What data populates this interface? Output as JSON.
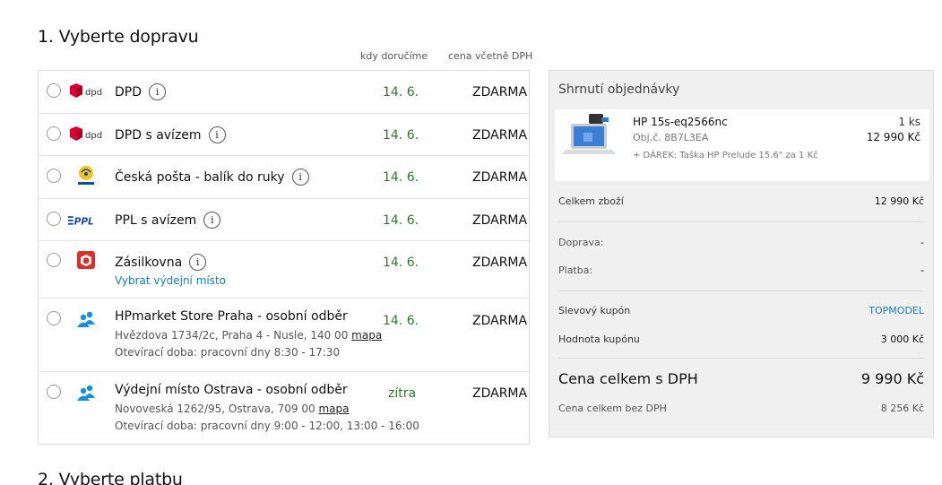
{
  "section1_title": "1. Vyberte dopravu",
  "section2_title": "2. Vyberte platbu",
  "columns": {
    "when": "kdy doručíme",
    "price": "cena včetně DPH"
  },
  "shipping": [
    {
      "name": "DPD",
      "logo": "dpd-logo",
      "date": "14. 6.",
      "price": "ZDARMA"
    },
    {
      "name": "DPD s avízem",
      "logo": "dpd-logo",
      "date": "14. 6.",
      "price": "ZDARMA"
    },
    {
      "name": "Česká pošta - balík do ruky",
      "logo": "ceska-posta-logo",
      "date": "14. 6.",
      "price": "ZDARMA"
    },
    {
      "name": "PPL s avízem",
      "logo": "ppl-logo",
      "date": "14. 6.",
      "price": "ZDARMA"
    },
    {
      "name": "Zásilkovna",
      "logo": "zasilkovna-logo",
      "date": "14. 6.",
      "price": "ZDARMA",
      "link": "Vybrat výdejní místo"
    },
    {
      "name": "HPmarket Store Praha - osobní odběr",
      "logo": "people-icon",
      "date": "14. 6.",
      "price": "ZDARMA",
      "address": "Hvězdova 1734/2c, Praha 4 - Nusle, 140 00",
      "map": "mapa",
      "hours": "Otevírací doba: pracovní dny 8:30 - 17:30"
    },
    {
      "name": "Výdejní místo Ostrava - osobní odběr",
      "logo": "people-icon",
      "date": "zítra",
      "price": "ZDARMA",
      "address": "Novoveská 1262/95, Ostrava, 709 00",
      "map": "mapa",
      "hours": "Otevírací doba: pracovní dny 9:00 - 12:00, 13:00 - 16:00"
    }
  ],
  "summary": {
    "title": "Shrnutí objednávky",
    "product": {
      "name": "HP 15s-eq2566nc",
      "code": "Obj.č. 8B7L3EA",
      "gift": "+ DÁREK: Taška HP Prelude 15.6\" za 1 Kč",
      "qty": "1 ks",
      "price": "12 990 Kč"
    },
    "goods_label": "Celkem zboží",
    "goods_value": "12 990 Kč",
    "shipping_label": "Doprava:",
    "shipping_value": "-",
    "payment_label": "Platba:",
    "payment_value": "-",
    "coupon_label": "Slevový kupón",
    "coupon_value": "TOPMODEL",
    "coupon_amount_label": "Hodnota kupónu",
    "coupon_amount_value": "3 000 Kč",
    "total_label": "Cena celkem s DPH",
    "total_value": "9 990 Kč",
    "total_novat_label": "Cena celkem bez DPH",
    "total_novat_value": "8 256 Kč"
  },
  "colors": {
    "date_green": "#2d7a2d",
    "link_blue": "#1a7bb9",
    "dpd_red": "#dc0032",
    "people_blue": "#1a8fd6"
  }
}
